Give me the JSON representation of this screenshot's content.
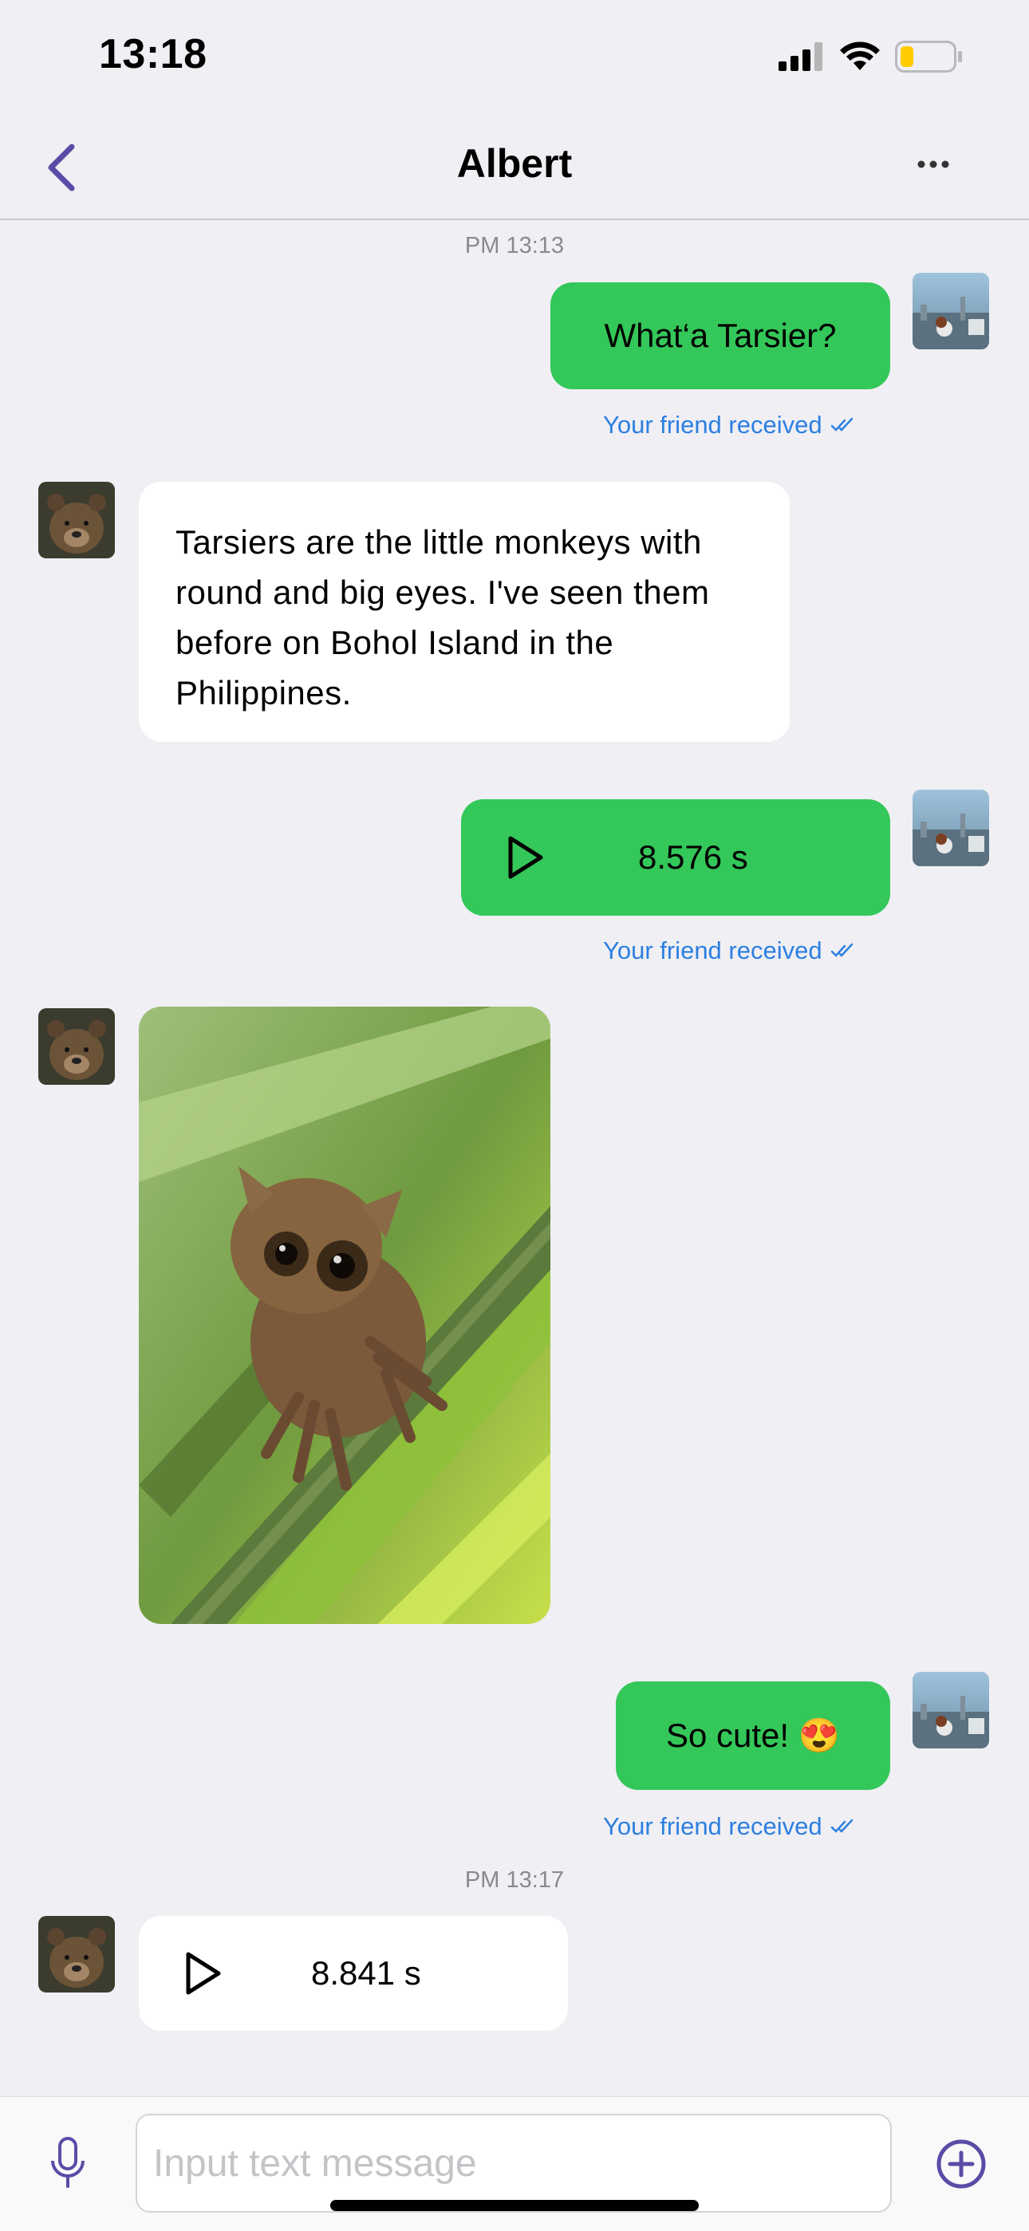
{
  "status_bar": {
    "time": "13:18",
    "battery_level": 0.25
  },
  "header": {
    "title": "Albert"
  },
  "messages": {
    "timestamp_1": "PM 13:13",
    "m1_text": "What‘a Tarsier?",
    "m1_receipt": "Your friend received",
    "m2_text": "Tarsiers are the little monkeys with round and big eyes. I've seen them before on Bohol Island in the Philippines.",
    "m3_duration": "8.576 s",
    "m3_receipt": "Your friend received",
    "m4_image": "tarsier-photo",
    "m5_text": "So cute! 😍",
    "m5_receipt": "Your friend received",
    "timestamp_2": "PM 13:17",
    "m6_duration": "8.841 s"
  },
  "composer": {
    "placeholder": "Input text message"
  },
  "colors": {
    "accent": "#5b4ba7",
    "bubble_out": "#34c759",
    "receipt": "#2d7fe0"
  }
}
